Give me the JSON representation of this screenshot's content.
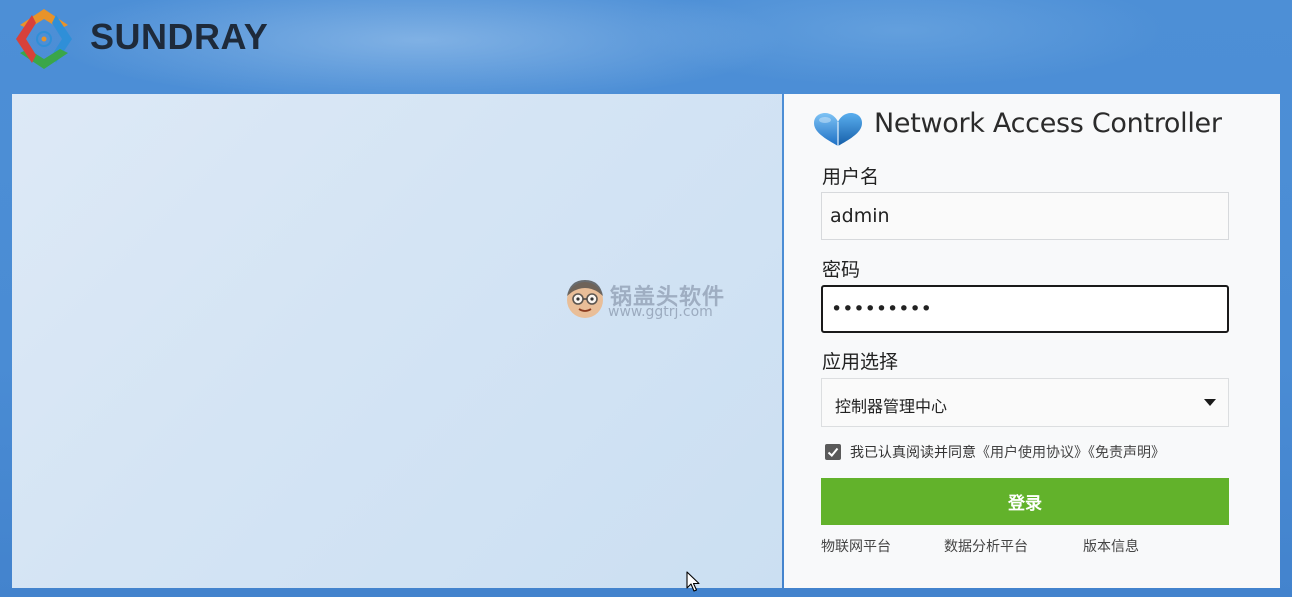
{
  "brand": {
    "name": "SUNDRAY",
    "logo_icon": "sundray-logo-icon"
  },
  "watermark": {
    "title": "锅盖头软件",
    "url": "www.ggtrj.com"
  },
  "login": {
    "product_icon": "cloud-heart-icon",
    "title": "Network Access Controller",
    "username_label": "用户名",
    "username_value": "admin",
    "password_label": "密码",
    "password_value": "•••••••••",
    "app_label": "应用选择",
    "app_selected": "控制器管理中心",
    "agree_checked": true,
    "agree_text": "我已认真阅读并同意",
    "agree_link_1": "《用户使用协议》",
    "agree_link_2": "《免责声明》",
    "login_button": "登录",
    "accent_color": "#62b22b"
  },
  "footer": {
    "links": [
      "物联网平台",
      "数据分析平台",
      "版本信息"
    ]
  }
}
